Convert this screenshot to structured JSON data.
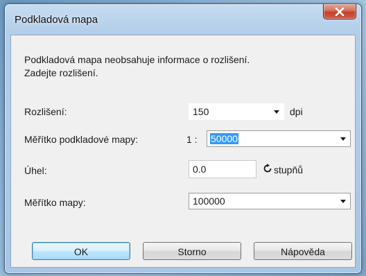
{
  "dialog": {
    "title": "Podkladová mapa",
    "message_line1": "Podkladová mapa neobsahuje informace o rozlišení.",
    "message_line2": "Zadejte rozlišení."
  },
  "fields": {
    "resolution": {
      "label": "Rozlišení:",
      "value": "150",
      "unit": "dpi"
    },
    "base_scale": {
      "label": "Měřítko podkladové mapy:",
      "prefix": "1 :",
      "value": "50000"
    },
    "angle": {
      "label": "Úhel:",
      "value": "0.0",
      "unit": "stupňů"
    },
    "map_scale": {
      "label": "Měřítko mapy:",
      "value": "100000"
    }
  },
  "buttons": {
    "ok": "OK",
    "cancel": "Storno",
    "help": "Nápověda"
  },
  "colors": {
    "selection": "#3399ff",
    "close_button": "#c2412a"
  },
  "icons": {
    "close": "close-icon",
    "rotate": "rotate-icon",
    "dropdown": "chevron-down-icon"
  }
}
